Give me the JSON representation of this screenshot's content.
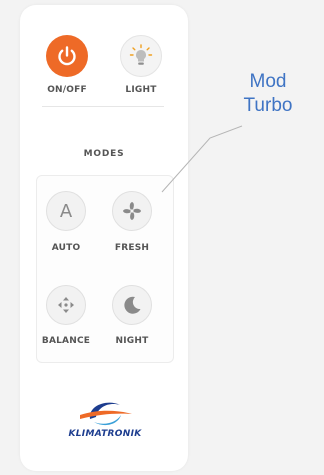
{
  "remote": {
    "power": {
      "label": "ON/OFF",
      "icon": "power-icon",
      "color": "#ee6a27"
    },
    "light": {
      "label": "LIGHT",
      "icon": "lightbulb-icon"
    },
    "modes_title": "MODES",
    "modes": [
      {
        "label": "AUTO",
        "icon": "letter-a-icon"
      },
      {
        "label": "FRESH",
        "icon": "fan-icon"
      },
      {
        "label": "BALANCE",
        "icon": "balance-icon"
      },
      {
        "label": "NIGHT",
        "icon": "moon-icon"
      }
    ],
    "brand": "KLIMATRONIK"
  },
  "callout": {
    "line1": "Mod",
    "line2": "Turbo",
    "color": "#3f74c4"
  }
}
